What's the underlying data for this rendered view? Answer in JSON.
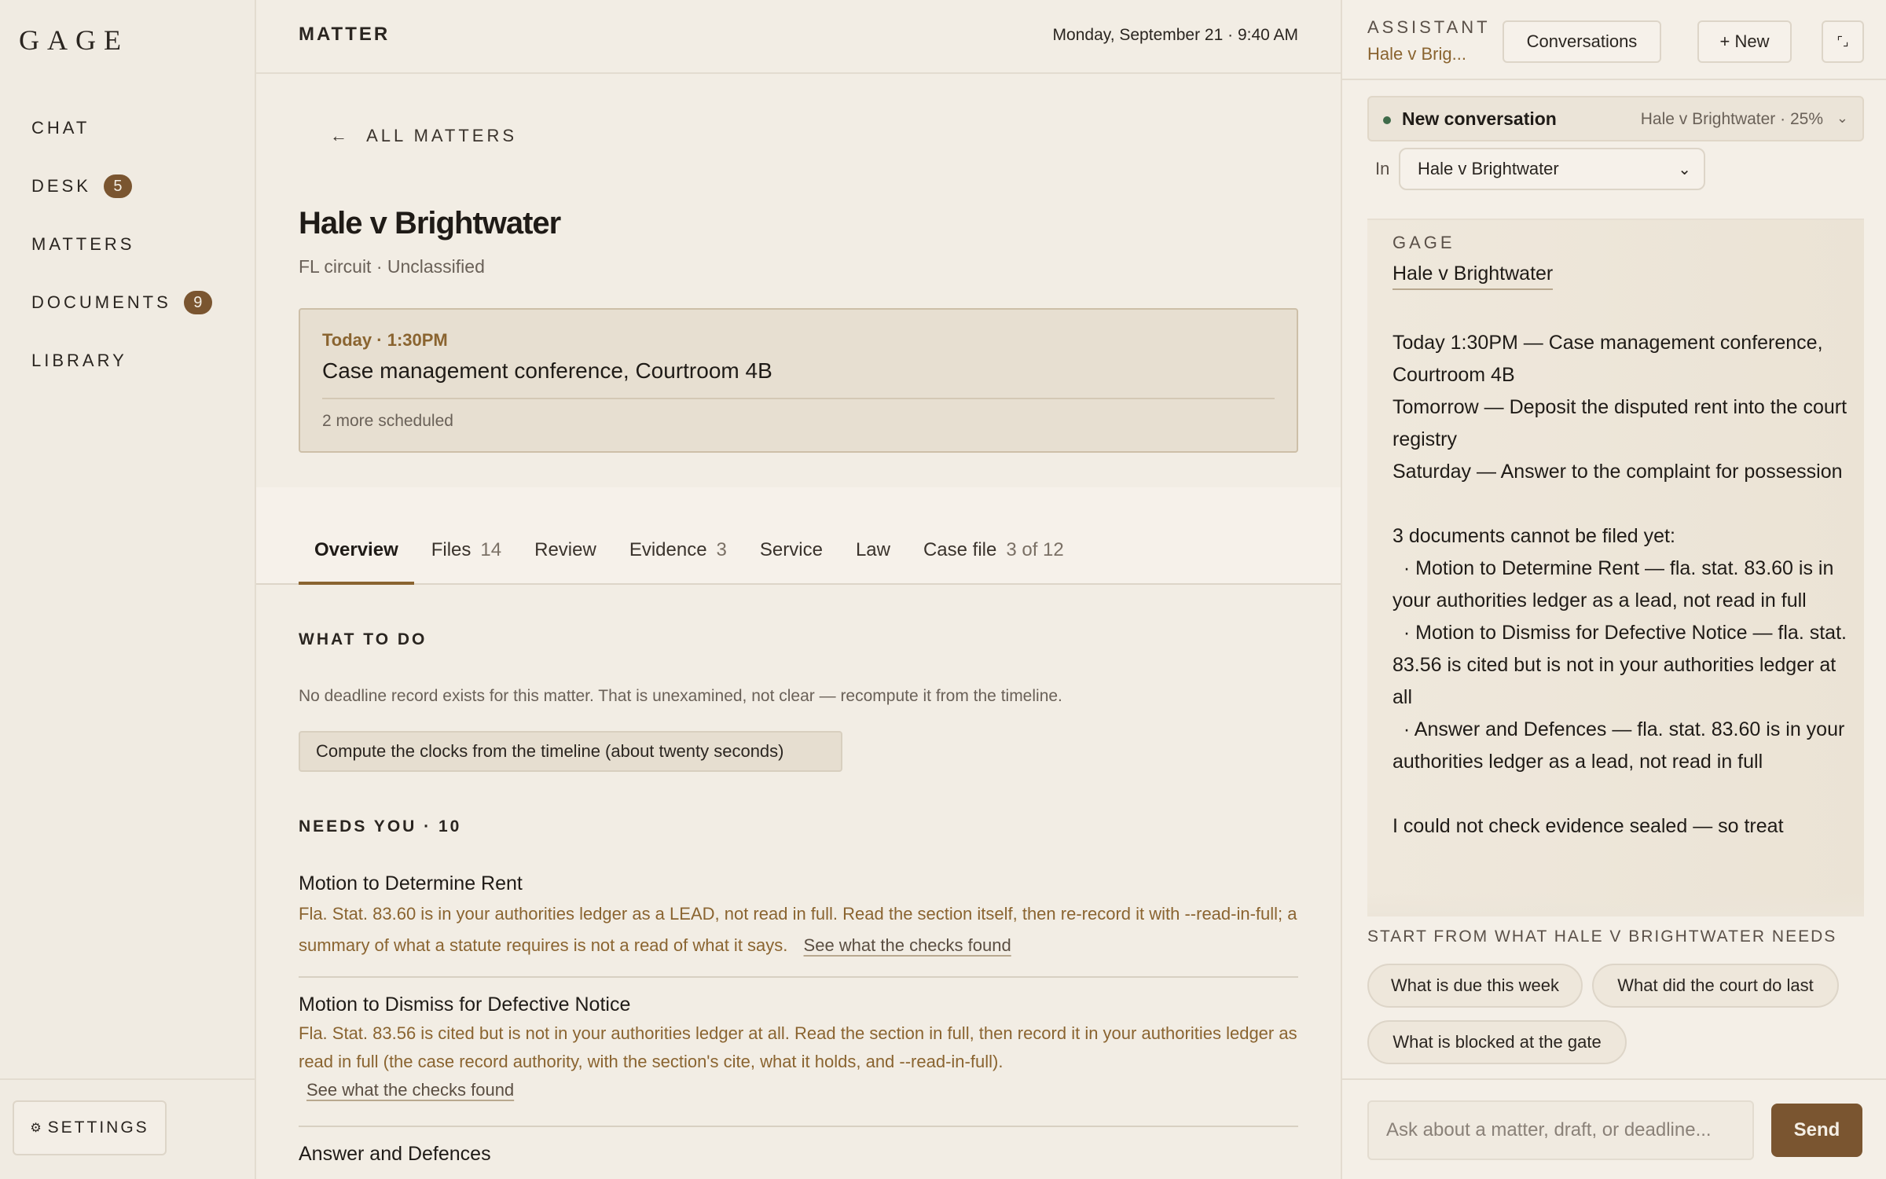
{
  "colors": {
    "accent": "#7a5530",
    "accent_text": "#8a6430",
    "background": "#f2ede4",
    "status_dot": "#3f6b4a"
  },
  "sidebar": {
    "logo": "GAGE",
    "items": [
      {
        "label": "CHAT",
        "badge": ""
      },
      {
        "label": "DESK",
        "badge": "5"
      },
      {
        "label": "MATTERS",
        "badge": ""
      },
      {
        "label": "DOCUMENTS",
        "badge": "9"
      },
      {
        "label": "LIBRARY",
        "badge": ""
      }
    ],
    "settings": {
      "icon": "gear-icon",
      "glyph": "⚙",
      "label": "SETTINGS"
    }
  },
  "header": {
    "title": "MATTER",
    "datetime": "Monday, September 21 · 9:40 AM"
  },
  "matter": {
    "back_icon": "arrow-left-icon",
    "back_glyph": "←",
    "back_label": "ALL MATTERS",
    "title": "Hale v Brightwater",
    "subtitle": "FL circuit · Unclassified",
    "event": {
      "when": "Today · 1:30PM",
      "title": "Case management conference, Courtroom 4B",
      "more": "2 more scheduled"
    },
    "tabs": [
      {
        "label": "Overview",
        "count": "",
        "active": true
      },
      {
        "label": "Files",
        "count": "14"
      },
      {
        "label": "Review",
        "count": ""
      },
      {
        "label": "Evidence",
        "count": "3"
      },
      {
        "label": "Service",
        "count": ""
      },
      {
        "label": "Law",
        "count": ""
      },
      {
        "label": "Case file",
        "count": "3 of 12"
      }
    ],
    "todo": {
      "label": "WHAT TO DO",
      "text": "No deadline record exists for this matter. That is unexamined, not clear — recompute it from the timeline.",
      "button": "Compute the clocks from the timeline (about twenty seconds)"
    },
    "needs": {
      "label": "NEEDS YOU · 10",
      "items": [
        {
          "title": "Motion to Determine Rent",
          "desc": "Fla. Stat. 83.60 is in your authorities ledger as a LEAD, not read in full. Read the section itself, then re-record it with --read-in-full; a summary of what a statute requires is not a read of what it says.",
          "link": "See what the checks found"
        },
        {
          "title": "Motion to Dismiss for Defective Notice",
          "desc": "Fla. Stat. 83.56 is cited but is not in your authorities ledger at all. Read the section in full, then record it in your authorities ledger as read in full (the case record authority, with the section's cite, what it holds, and --read-in-full).",
          "link": "See what the checks found"
        },
        {
          "title": "Answer and Defences",
          "desc": "",
          "link": ""
        }
      ]
    }
  },
  "assistant": {
    "label": "ASSISTANT",
    "matter_short": "Hale v Brig...",
    "conversations_button": "Conversations",
    "new_button": "+ New",
    "expand_icon": "expand-icon",
    "expand_glyph": "⌜⌟",
    "conversation": {
      "title": "New conversation",
      "meta": "Hale v Brightwater · 25%",
      "chevron_icon": "chevron-down-icon",
      "chevron_glyph": "⌄"
    },
    "scope": {
      "label": "In",
      "selected": "Hale v Brightwater",
      "chevron_glyph": "⌄"
    },
    "message": {
      "sender": "GAGE",
      "matter": "Hale v Brightwater",
      "body": "Today 1:30PM — Case management conference, Courtroom 4B\nTomorrow — Deposit the disputed rent into the court registry\nSaturday — Answer to the complaint for possession\n\n3 documents cannot be filed yet:\n  · Motion to Determine Rent — fla. stat. 83.60 is in your authorities ledger as a lead, not read in full\n  · Motion to Dismiss for Defective Notice — fla. stat. 83.56 is cited but is not in your authorities ledger at all\n  · Answer and Defences — fla. stat. 83.60 is in your authorities ledger as a lead, not read in full\n\nI could not check evidence sealed — so treat"
    },
    "suggestions": {
      "label": "START FROM WHAT HALE V BRIGHTWATER NEEDS",
      "chips": [
        "What is due this week",
        "What did the court do last",
        "What is blocked at the gate"
      ]
    },
    "input": {
      "placeholder": "Ask about a matter, draft, or deadline...",
      "send": "Send"
    }
  }
}
